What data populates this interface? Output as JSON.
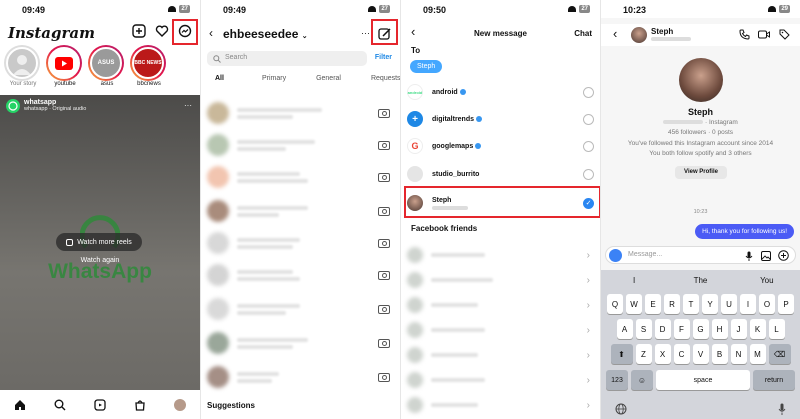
{
  "colors": {
    "highlight": "#e5262d",
    "accent_blue": "#44a7ff",
    "bubble": "#4b5bf5",
    "whatsapp_green": "#2f8a3a"
  },
  "panel1": {
    "time": "09:49",
    "battery": "27",
    "logo": "Instagram",
    "stories": [
      {
        "label": "Your story"
      },
      {
        "label": "youtube"
      },
      {
        "label": "asus",
        "badge": "ASUS"
      },
      {
        "label": "bbcnews",
        "badge": "BBC NEWS"
      }
    ],
    "reel": {
      "account": "whatsapp",
      "subtitle": "whatsapp · Original audio",
      "watch_more": "Watch more reels",
      "watch_again": "Watch again",
      "brand": "WhatsApp"
    },
    "icons": [
      "plus-square-icon",
      "heart-icon",
      "messenger-icon",
      "home-icon",
      "search-icon",
      "reels-icon",
      "shop-icon",
      "profile-icon"
    ]
  },
  "panel2": {
    "time": "09:49",
    "battery": "27",
    "title": "ehbeeseedee",
    "search_placeholder": "Search",
    "filter": "Filter",
    "tabs": [
      "All",
      "Primary",
      "General",
      "Requests"
    ],
    "suggestions": "Suggestions"
  },
  "panel3": {
    "time": "09:50",
    "battery": "27",
    "title": "New message",
    "chat": "Chat",
    "to": "To",
    "chip": "Steph",
    "users": [
      {
        "name": "android",
        "verified": true,
        "avatar": "android"
      },
      {
        "name": "digitaltrends",
        "verified": true,
        "avatar": "+"
      },
      {
        "name": "googlemaps",
        "verified": true,
        "avatar": "G"
      },
      {
        "name": "studio_burrito",
        "verified": false,
        "avatar": ""
      },
      {
        "name": "Steph",
        "verified": false,
        "avatar": "",
        "selected": true
      }
    ],
    "facebook_friends": "Facebook friends"
  },
  "panel4": {
    "time": "10:23",
    "battery": "29",
    "name": "Steph",
    "profile_name": "Steph",
    "profile_site": "· Instagram",
    "stats": "456 followers · 0 posts",
    "followed_since": "You've followed this Instagram account since 2014",
    "mutual": "You both follow spotify and 3 others",
    "view_profile": "View Profile",
    "timestamp": "10:23",
    "message": "Hi, thank you for following us!",
    "message_placeholder": "Message...",
    "predictions": [
      "I",
      "The",
      "You"
    ],
    "keys_row1": [
      "Q",
      "W",
      "E",
      "R",
      "T",
      "Y",
      "U",
      "I",
      "O",
      "P"
    ],
    "keys_row2": [
      "A",
      "S",
      "D",
      "F",
      "G",
      "H",
      "J",
      "K",
      "L"
    ],
    "keys_row3": [
      "Z",
      "X",
      "C",
      "V",
      "B",
      "N",
      "M"
    ],
    "key_123": "123",
    "key_space": "space",
    "key_return": "return"
  }
}
